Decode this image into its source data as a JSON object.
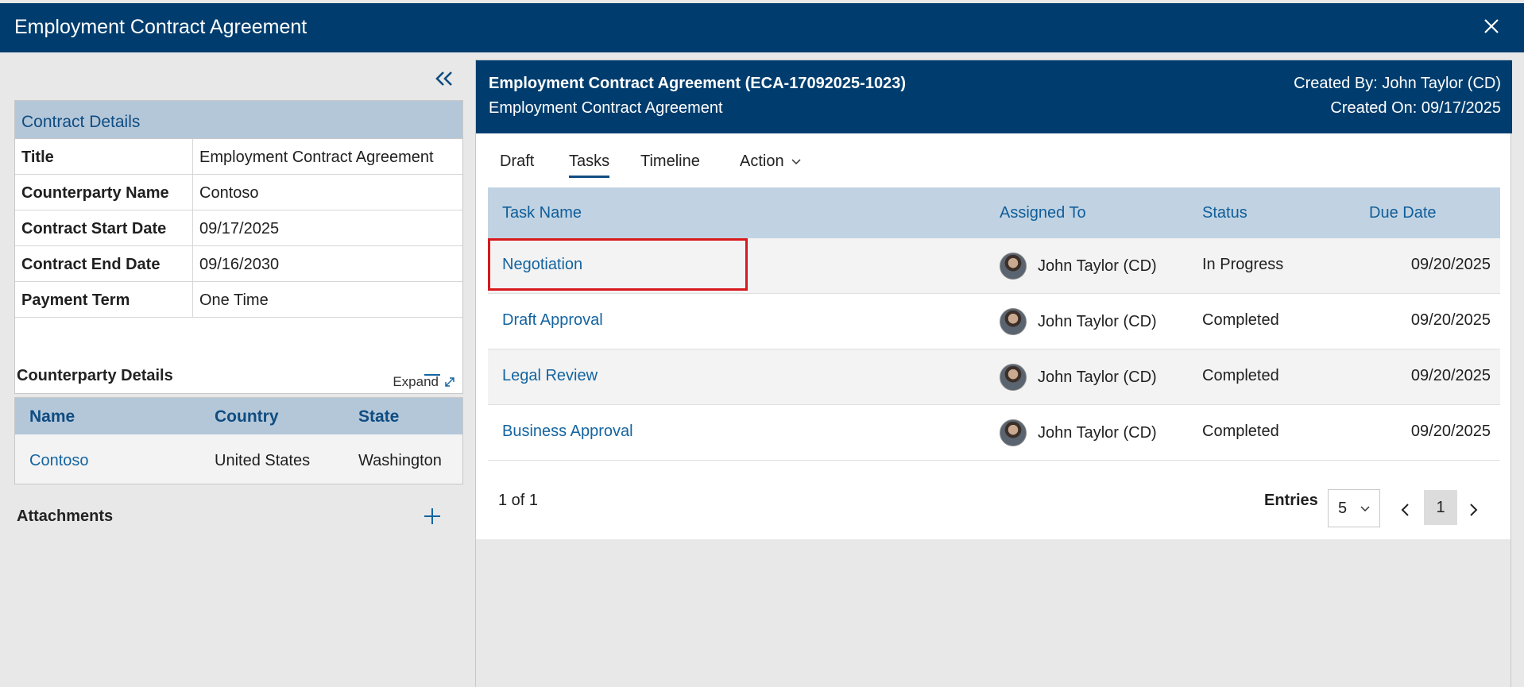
{
  "window": {
    "title": "Employment Contract Agreement",
    "close_icon": "close-icon"
  },
  "left_panel": {
    "collapse_icon": "double-chevron-left-icon",
    "contract_details": {
      "header": "Contract Details",
      "rows": [
        {
          "label": "Title",
          "value": "Employment Contract Agreement"
        },
        {
          "label": "Counterparty Name",
          "value": "Contoso"
        },
        {
          "label": "Contract Start Date",
          "value": "09/17/2025"
        },
        {
          "label": "Contract End Date",
          "value": "09/16/2030"
        },
        {
          "label": "Payment Term",
          "value": "One Time"
        }
      ],
      "expand_label": "Expand"
    },
    "counterparty_details": {
      "title": "Counterparty Details",
      "columns": [
        "Name",
        "Country",
        "State"
      ],
      "rows": [
        {
          "name": "Contoso",
          "country": "United States",
          "state": "Washington"
        }
      ]
    },
    "attachments": {
      "title": "Attachments"
    }
  },
  "main": {
    "header": {
      "title": "Employment Contract Agreement (ECA-17092025-1023)",
      "subtitle": "Employment Contract Agreement",
      "created_by": "Created By: John Taylor (CD)",
      "created_on": "Created On: 09/17/2025"
    },
    "tabs": [
      {
        "label": "Draft"
      },
      {
        "label": "Tasks",
        "active": true
      },
      {
        "label": "Timeline"
      },
      {
        "label": "Action"
      }
    ],
    "tasks_table": {
      "columns": [
        "Task Name",
        "Assigned To",
        "Status",
        "Due Date"
      ],
      "rows": [
        {
          "task": "Negotiation",
          "assigned": "John Taylor (CD)",
          "status": "In Progress",
          "due": "09/20/2025"
        },
        {
          "task": "Draft Approval",
          "assigned": "John Taylor (CD)",
          "status": "Completed",
          "due": "09/20/2025"
        },
        {
          "task": "Legal Review",
          "assigned": "John Taylor (CD)",
          "status": "Completed",
          "due": "09/20/2025"
        },
        {
          "task": "Business Approval",
          "assigned": "John Taylor (CD)",
          "status": "Completed",
          "due": "09/20/2025"
        }
      ]
    },
    "pagination": {
      "summary": "1 of 1",
      "entries_label": "Entries",
      "entries_value": "5",
      "current_page": "1"
    }
  },
  "colors": {
    "header_bg": "#003d6e",
    "table_header_bg": "#c1d3e2",
    "link": "#1464a0",
    "highlight": "#d7191c"
  }
}
